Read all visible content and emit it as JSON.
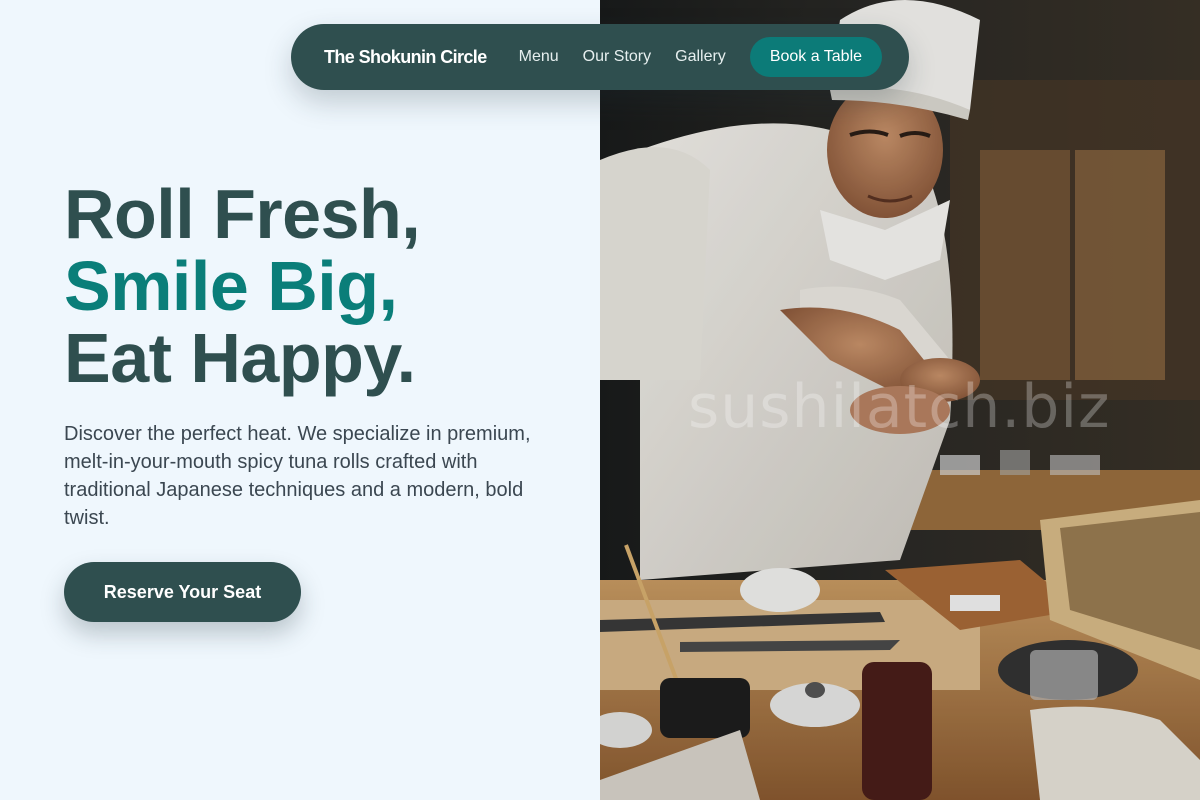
{
  "nav": {
    "brand": "The Shokunin Circle",
    "links": [
      "Menu",
      "Our Story",
      "Gallery"
    ],
    "cta": "Book a Table"
  },
  "hero": {
    "headline": [
      "Roll Fresh,",
      "Smile Big,",
      "Eat Happy."
    ],
    "description": "Discover the perfect heat. We specialize in premium, melt-in-your-mouth spicy tuna rolls crafted with traditional Japanese techniques and a modern, bold twist.",
    "cta": "Reserve Your Seat"
  },
  "photo": {
    "watermark": "sushilatch.biz"
  },
  "colors": {
    "nav_background": "#2f4f4f",
    "accent": "#0a7e79",
    "page_background": "#eff7fd",
    "headline_dark": "#2f4f4f"
  }
}
